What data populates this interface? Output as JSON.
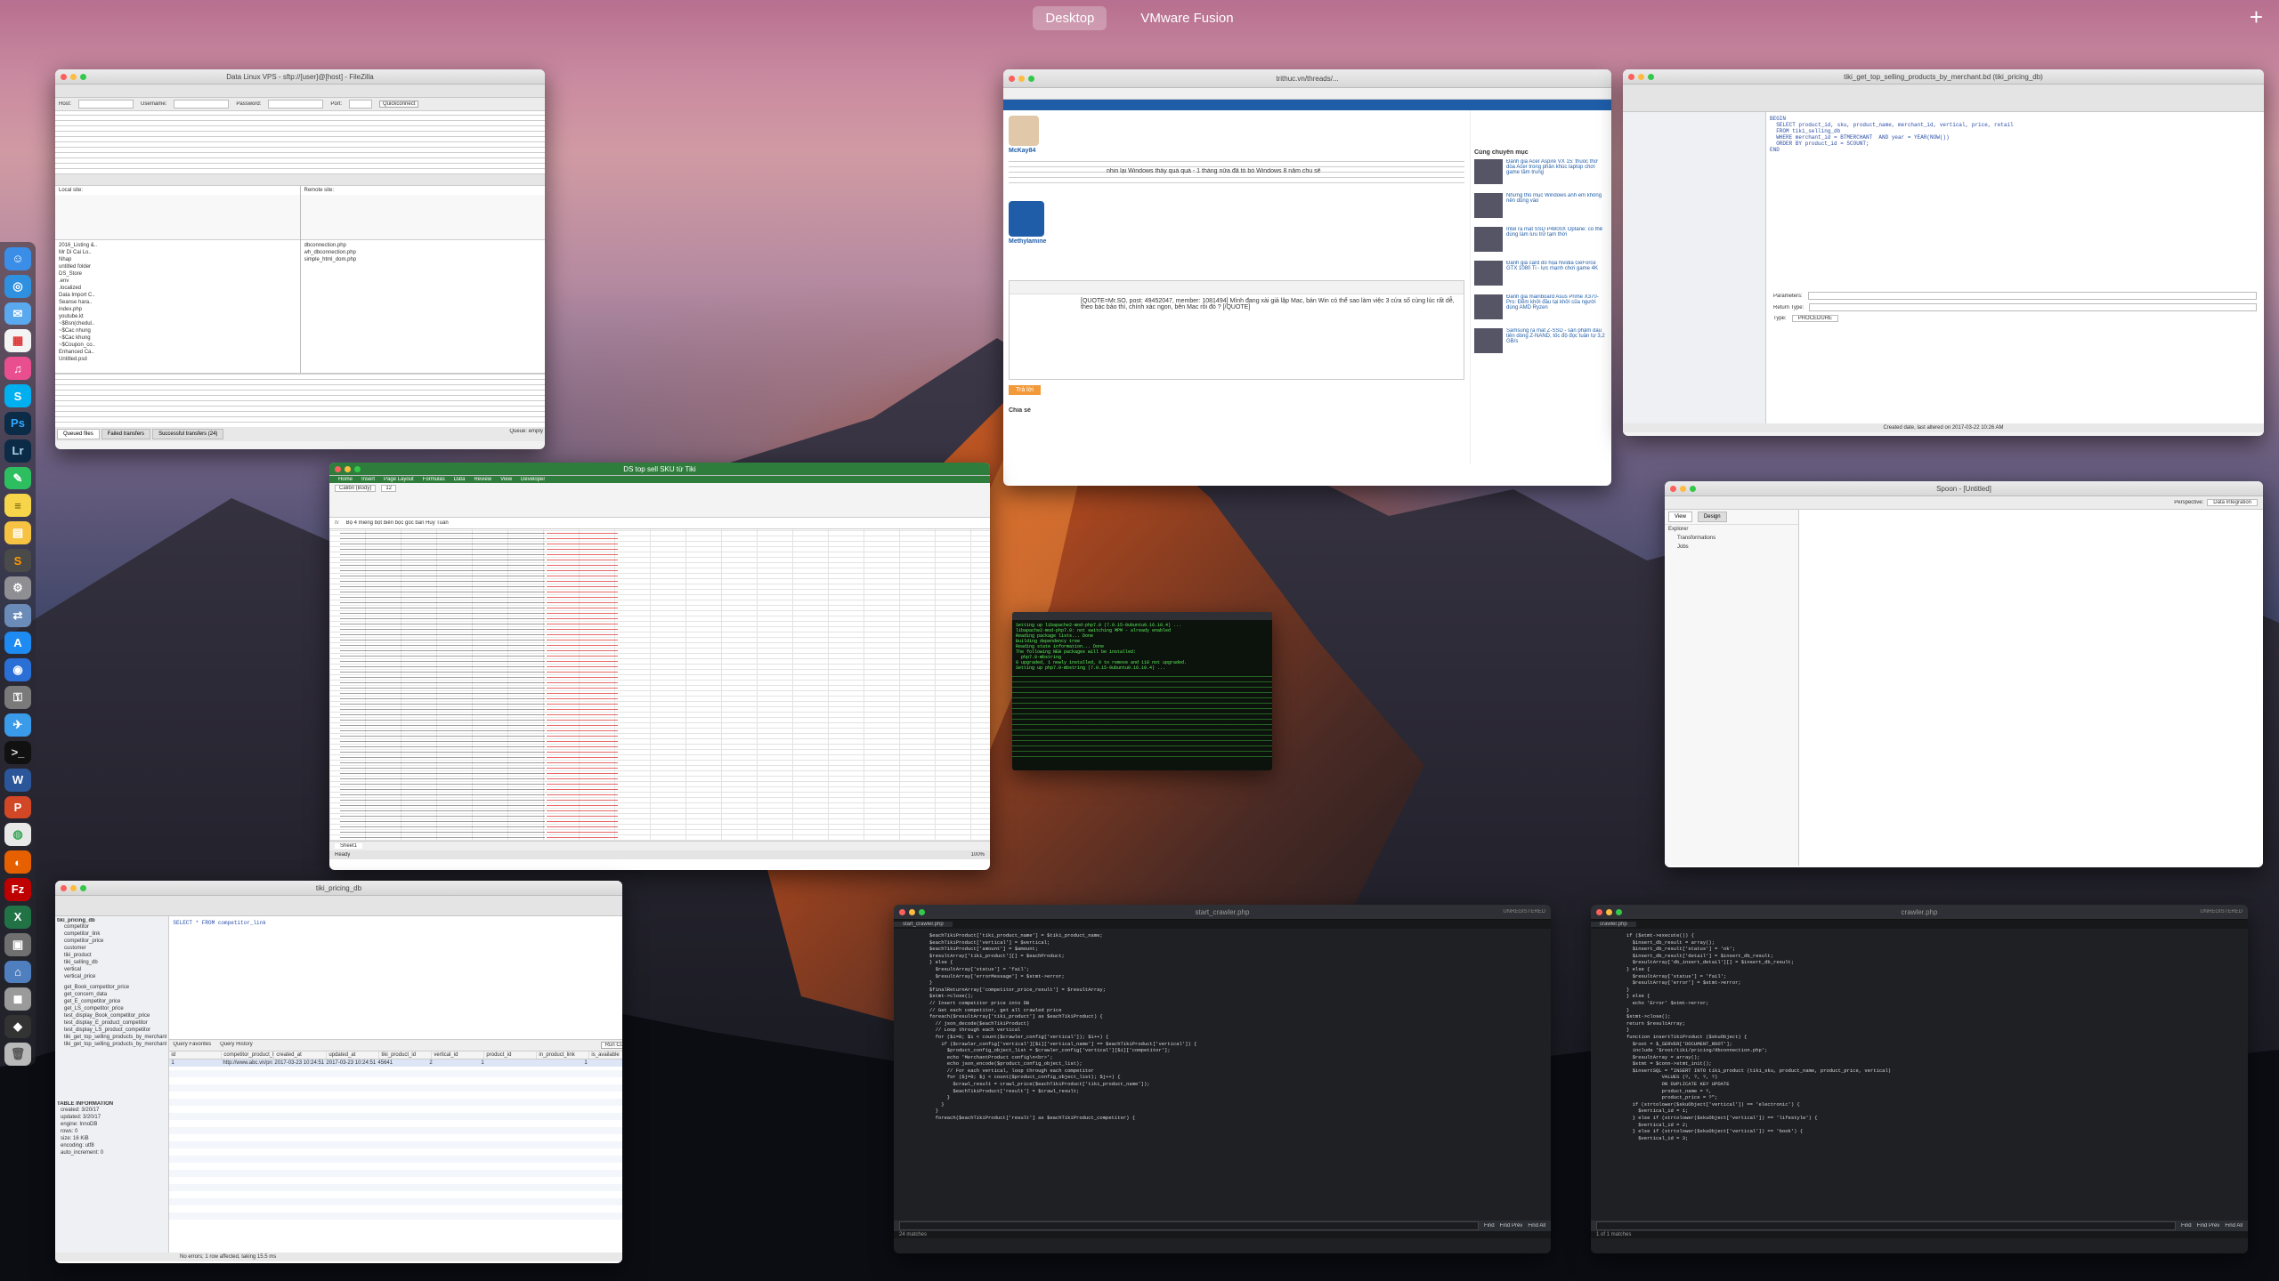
{
  "mission_control": {
    "spaces": [
      "Desktop",
      "VMware Fusion"
    ],
    "add_symbol": "+"
  },
  "dock": {
    "icons": [
      "finder-icon",
      "safari-icon",
      "mail-icon",
      "calendar-icon",
      "itunes-icon",
      "skype-icon",
      "photoshop-icon",
      "lightroom-icon",
      "evernote-icon",
      "notes-icon",
      "stickies-icon",
      "sublime-icon",
      "preferences-icon",
      "migration-icon",
      "appstore-icon",
      "safari2-icon",
      "keychain-icon",
      "mail2-icon",
      "terminal-icon",
      "word-icon",
      "powerpoint-icon",
      "chrome-icon",
      "firefox-icon",
      "filezilla-icon",
      "excel-icon",
      "vmware-icon",
      "network-icon",
      "disk-icon",
      "cleaner-icon",
      "trash-icon"
    ]
  },
  "filezilla": {
    "title": "Data Linux VPS - sftp://[user]@[host] - FileZilla",
    "host_label": "Host:",
    "username_label": "Username:",
    "password_label": "Password:",
    "port_label": "Port:",
    "quickconnect": "Quickconnect",
    "local_site": "Local site:",
    "remote_site": "Remote site:",
    "local_files": [
      "2016_Listing &..",
      "Mr Di Cai Lo..",
      "Nhap",
      "untitled folder",
      "DS_Store",
      ".env",
      ".localized",
      "Data Import C..",
      "Seanse hara..",
      "index.php",
      "youtube.kt",
      "~$Bsn(chedul..",
      "~$Cac nhung",
      "~$Cac khung",
      "~$Coupon_co..",
      "Enhanced Ca..",
      "Untitled.psd"
    ],
    "remote_files": [
      "dbconnection.php",
      "wh_dbconnection.php",
      "simple_html_dom.php"
    ],
    "tabs": [
      "Queued files",
      "Failed transfers",
      "Successful transfers (24)"
    ],
    "queue": "Queue: empty"
  },
  "safari": {
    "url": "trithuc.vn/threads/...",
    "forum_post": "nhin lại Windows thấy quá quá - 1 tháng nữa đã tỏ bò Windows 8 năm chu sẽ",
    "user1": "McKay84",
    "user2": "Methylamine",
    "quote_text": "[QUOTE=Mr.SO, post: 49452047, member: 1081494] Mình đang xài giả lập Mac, bản Win có thể sao làm việc 3 cửa số cùng lúc rất dễ, theo bác bảo thì, chính xác ngon, bên Mac rồi đó ? [/QUOTE]",
    "related_heading": "Cùng chuyên mục",
    "related": [
      "Đánh giá Acer Aspire VX 15: thuốc thử dòa Acer trong phân khúc laptop chơi game tầm trung",
      "Những thủ mục Windows anh em không nên dùng vào",
      "Intel ra mắt SSD P4800X Optane: có thể dùng làm lưu trữ tạm thời",
      "Đánh giá card đồ họa Nvidia GeForce GTX 1080 Ti - lực mạnh chơi game 4K",
      "Đánh giá mainboard Asus Prime X370-Pro: Đếm khởi đầu tại khởi của người dùng AMD Ryzen",
      "Samsung ra mắt Z-SSD - sản phẩm đầu tiên dòng Z-NAND, tốc độ đọc tuần tự 3,2 GB/s"
    ],
    "reply_label": "Trả lời",
    "share_label": "Chia sẻ"
  },
  "excel": {
    "title": "DS top sell SKU từ Tiki",
    "tabs": [
      "Home",
      "Insert",
      "Page Layout",
      "Formulas",
      "Data",
      "Review",
      "View",
      "Developer"
    ],
    "formula": "Bộ 4 miếng bọt biển bọc góc bàn Huy Tuấn",
    "font_name": "Calibri (Body)",
    "font_size": "12",
    "sheet": "Sheet1",
    "status": "Ready",
    "zoom": "100%"
  },
  "terminal": {
    "lines": [
      "Setting up libapache2-mod-php7.0 (7.0.15-0ubuntu0.16.10.4) ...",
      "libapache2-mod-php7.0: not switching MPM - already enabled",
      "Reading package lists... Done",
      "Building dependency tree",
      "Reading state information... Done",
      "The following NEW packages will be installed:",
      "  php7.0-mbstring",
      "0 upgraded, 1 newly installed, 0 to remove and 118 not upgraded.",
      "Setting up php7.0-mbstring (7.0.15-0ubuntu0.16.10.4) ..."
    ]
  },
  "db_tool": {
    "title": "tiki_get_top_selling_products_by_merchant.bd (tiki_pricing_db)",
    "params_label": "Parameters:",
    "return_label": "Return Type:",
    "type_label": "Type:",
    "type_value": "PROCEDURE",
    "status": "Created date, last altered on 2017-03-22 10:26 AM",
    "code": [
      "BEGIN",
      "  SELECT product_id, sku, product_name, merchant_id, vertical, price, retail",
      "  FROM tiki_selling_db",
      "  WHERE merchant_id = BTMERCHANT  AND year = YEAR(NOW())",
      "  ORDER BY product_id = SCOUNT;",
      "END"
    ]
  },
  "spoon": {
    "title": "Spoon - [Untitled]",
    "perspective_label": "Perspective:",
    "perspective_value": "Data Integration",
    "tabs": [
      "View",
      "Design"
    ],
    "explorer_label": "Explorer",
    "tree": [
      "Transformations",
      "Jobs"
    ]
  },
  "sequel": {
    "title": "tiki_pricing_db",
    "db_label": "tiki_pricing_db",
    "query": "SELECT * FROM competitor_link",
    "tables": [
      "competitor",
      "competitor_link",
      "competitor_price",
      "customer",
      "tiki_product",
      "tiki_selling_db",
      "vertical",
      "vertical_price"
    ],
    "procs": [
      "get_Book_competitor_price",
      "get_concern_data",
      "get_E_competitor_price",
      "get_LS_competitor_price",
      "test_display_Book_competitor_price",
      "test_display_E_product_competitor",
      "test_display_LS_product_competitor",
      "tiki_get_top_selling_products_by_merchant",
      "tiki_get_top_selling_products_by_merchant"
    ],
    "columns": [
      "id",
      "competitor_product_link",
      "created_at",
      "updated_at",
      "tiki_product_id",
      "vertical_id",
      "product_id",
      "in_product_link",
      "is_available"
    ],
    "row": [
      "1",
      "http://www.abc.vn/product/...",
      "2017-03-23 10:24:51",
      "2017-03-23 10:24:51",
      "45641",
      "2",
      "1",
      "",
      "1"
    ],
    "info_heading": "TABLE INFORMATION",
    "info": [
      "created: 3/20/17",
      "updated: 3/20/17",
      "engine: InnoDB",
      "rows: 0",
      "size: 16 KiB",
      "encoding: utf8",
      "auto_increment: 0"
    ],
    "footer": "No errors; 1 row affected, taking 15.5 ms",
    "run_label": "Run Current",
    "history_label": "Query History",
    "fav_label": "Query Favorites"
  },
  "sublime1": {
    "title": "start_crawler.php",
    "tab": "start_crawler.php",
    "path": "UNREGISTERED",
    "code": [
      "$eachTikiProduct['tiki_product_name'] = $tiki_product_name;",
      "$eachTikiProduct['vertical'] = $vertical;",
      "$eachTikiProduct['amount'] = $amount;",
      "$resultArray['tiki_product'][] = $eachProduct;",
      "} else {",
      "  $resultArray['status'] = 'fail';",
      "  $resultArray['errorMessage'] = $stmt->error;",
      "}",
      "$finalReturnArray['competitor_price_result'] = $resultArray;",
      "$stmt->close();",
      "// Insert competitor price into DB",
      "// Get each competitor, get all crawled price",
      "foreach($resultArray['tiki_product'] as $eachTikiProduct) {",
      "  // json_decode($eachTikiProduct)",
      "  // Loop through each vertical",
      "  for ($i=0; $i < count($crawler_config['vertical']); $i++) {",
      "    if ($crawler_config['vertical'][$i]['vertical_name'] == $eachTikiProduct['vertical']) {",
      "      $product_config_object_list = $crawler_config['vertical'][$i]['competitor'];",
      "      echo 'MerchantProduct config\\n<br>';",
      "      echo json_encode($product_config_object_list);",
      "      // For each vertical, loop through each competitor",
      "      for ($j=0; $j < count($product_config_object_list); $j++) {",
      "        $crawl_result = crawl_price($eachTikiProduct['tiki_product_name']);",
      "        $eachTikiProduct['result'] = $crawl_result;",
      "      }",
      "    }",
      "  }",
      "  foreach($eachTikiProduct['result'] as $eachTikiProduct_competitor) {"
    ],
    "find_label": "Find",
    "find_prev": "Find Prev",
    "find_all": "Find All",
    "status": "24 matches"
  },
  "sublime2": {
    "title": "crawler.php",
    "tab": "crawler.php",
    "path": "UNREGISTERED",
    "code": [
      "if ($stmt->execute()) {",
      "  $insert_db_result = array();",
      "  $insert_db_result['status'] = 'ok';",
      "  $insert_db_result['detail'] = $insert_db_result;",
      "  $resultArray['db_insert_detail'][] = $insert_db_result;",
      "} else {",
      "  $resultArray['status'] = 'fail';",
      "  $resultArray['error'] = $stmt->error;",
      "}",
      "} else {",
      "  echo 'Error' $stmt->error;",
      "}",
      "$stmt->close();",
      "return $resultArray;",
      "}",
      "function insertTikiProduct ($skuObject) {",
      "  $root = $_SERVER['DOCUMENT_ROOT'];",
      "  include '$root/tiki/pricing/dbconnection.php';",
      "  $resultArray = array();",
      "  $stmt = $conn->stmt_init();",
      "  $insertSQL = \"INSERT INTO tiki_product (tiki_sku, product_name, product_price, vertical)",
      "            VALUES (?, ?, ?, ?)",
      "            ON DUPLICATE KEY UPDATE",
      "            product_name = ?,",
      "            product_price = ?\";",
      "  if (strtolower($skuObject['vertical']) == 'electronic') {",
      "    $vertical_id = 1;",
      "  } else if (strtolower($skuObject['vertical']) == 'lifestyle') {",
      "    $vertical_id = 2;",
      "  } else if (strtolower($skuObject['vertical']) == 'book') {",
      "    $vertical_id = 3;"
    ],
    "find_label": "Find",
    "find_prev": "Find Prev",
    "find_all": "Find All",
    "status": "1 of 1 matches"
  },
  "colors": {
    "excel_green": "#2f7d3c",
    "forum_blue": "#1f5da8",
    "terminal_green": "#50e650"
  }
}
